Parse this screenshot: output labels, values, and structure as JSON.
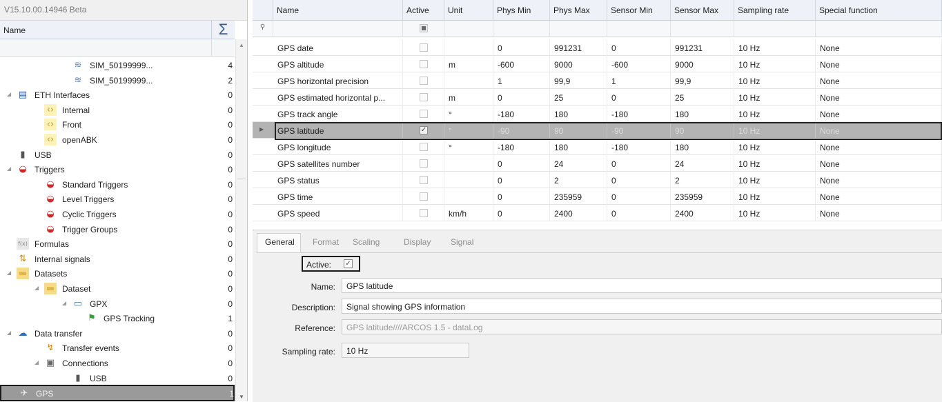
{
  "app": {
    "version": "V15.10.00.14946 Beta"
  },
  "tree": {
    "header_name": "Name",
    "header_sigma": "Σ",
    "rows": [
      {
        "label": "SIM_50199999...",
        "count": "4",
        "indent": 4,
        "icon": "signal-wave-icon",
        "expand": ""
      },
      {
        "label": "SIM_50199999...",
        "count": "2",
        "indent": 4,
        "icon": "signal-wave-icon",
        "expand": ""
      },
      {
        "label": "ETH Interfaces",
        "count": "0",
        "indent": 2,
        "icon": "ethernet-interface-icon",
        "expand": "◢"
      },
      {
        "label": "Internal",
        "count": "0",
        "indent": 3,
        "icon": "interface-port-icon",
        "expand": ""
      },
      {
        "label": "Front",
        "count": "0",
        "indent": 3,
        "icon": "interface-port-icon",
        "expand": ""
      },
      {
        "label": "openABK",
        "count": "0",
        "indent": 3,
        "icon": "interface-port-icon",
        "expand": ""
      },
      {
        "label": "USB",
        "count": "0",
        "indent": 2,
        "icon": "usb-icon",
        "expand": ""
      },
      {
        "label": "Triggers",
        "count": "0",
        "indent": 2,
        "icon": "trigger-icon",
        "expand": "◢"
      },
      {
        "label": "Standard Triggers",
        "count": "0",
        "indent": 3,
        "icon": "standard-trigger-icon",
        "expand": ""
      },
      {
        "label": "Level Triggers",
        "count": "0",
        "indent": 3,
        "icon": "level-trigger-icon",
        "expand": ""
      },
      {
        "label": "Cyclic Triggers",
        "count": "0",
        "indent": 3,
        "icon": "cyclic-trigger-icon",
        "expand": ""
      },
      {
        "label": "Trigger Groups",
        "count": "0",
        "indent": 3,
        "icon": "trigger-group-icon",
        "expand": ""
      },
      {
        "label": "Formulas",
        "count": "0",
        "indent": 2,
        "icon": "formula-icon",
        "expand": ""
      },
      {
        "label": "Internal signals",
        "count": "0",
        "indent": 2,
        "icon": "internal-signals-icon",
        "expand": ""
      },
      {
        "label": "Datasets",
        "count": "0",
        "indent": 2,
        "icon": "folder-icon",
        "expand": "◢"
      },
      {
        "label": "Dataset",
        "count": "0",
        "indent": 3,
        "icon": "folder-icon",
        "expand": "◢"
      },
      {
        "label": "GPX",
        "count": "0",
        "indent": 4,
        "icon": "gpx-file-icon",
        "expand": "◢"
      },
      {
        "label": "GPS Tracking",
        "count": "1",
        "indent": 5,
        "icon": "gps-tracking-icon",
        "expand": ""
      },
      {
        "label": "Data transfer",
        "count": "0",
        "indent": 2,
        "icon": "data-transfer-icon",
        "expand": "◢"
      },
      {
        "label": "Transfer events",
        "count": "0",
        "indent": 3,
        "icon": "transfer-event-icon",
        "expand": ""
      },
      {
        "label": "Connections",
        "count": "0",
        "indent": 3,
        "icon": "connection-icon",
        "expand": "◢"
      },
      {
        "label": "USB",
        "count": "0",
        "indent": 4,
        "icon": "usb-icon",
        "expand": ""
      },
      {
        "label": "GPS",
        "count": "1",
        "indent": 2,
        "icon": "gps-satellite-icon",
        "expand": "",
        "selected": true
      }
    ]
  },
  "grid": {
    "columns": [
      "Name",
      "Active",
      "Unit",
      "Phys Min",
      "Phys Max",
      "Sensor Min",
      "Sensor Max",
      "Sampling rate",
      "Special function"
    ],
    "rows": [
      {
        "name": "GPS date",
        "active": false,
        "unit": "",
        "phys_min": "0",
        "phys_max": "991231",
        "sensor_min": "0",
        "sensor_max": "991231",
        "rate": "10 Hz",
        "special": "None"
      },
      {
        "name": "GPS altitude",
        "active": false,
        "unit": "m",
        "phys_min": "-600",
        "phys_max": "9000",
        "sensor_min": "-600",
        "sensor_max": "9000",
        "rate": "10 Hz",
        "special": "None"
      },
      {
        "name": "GPS horizontal precision",
        "active": false,
        "unit": "",
        "phys_min": "1",
        "phys_max": "99,9",
        "sensor_min": "1",
        "sensor_max": "99,9",
        "rate": "10 Hz",
        "special": "None"
      },
      {
        "name": "GPS estimated horizontal p...",
        "active": false,
        "unit": "m",
        "phys_min": "0",
        "phys_max": "25",
        "sensor_min": "0",
        "sensor_max": "25",
        "rate": "10 Hz",
        "special": "None"
      },
      {
        "name": "GPS track angle",
        "active": false,
        "unit": "°",
        "phys_min": "-180",
        "phys_max": "180",
        "sensor_min": "-180",
        "sensor_max": "180",
        "rate": "10 Hz",
        "special": "None"
      },
      {
        "name": "GPS latitude",
        "active": true,
        "unit": "°",
        "phys_min": "-90",
        "phys_max": "90",
        "sensor_min": "-90",
        "sensor_max": "90",
        "rate": "10 Hz",
        "special": "None",
        "selected": true
      },
      {
        "name": "GPS longitude",
        "active": false,
        "unit": "°",
        "phys_min": "-180",
        "phys_max": "180",
        "sensor_min": "-180",
        "sensor_max": "180",
        "rate": "10 Hz",
        "special": "None"
      },
      {
        "name": "GPS satellites number",
        "active": false,
        "unit": "",
        "phys_min": "0",
        "phys_max": "24",
        "sensor_min": "0",
        "sensor_max": "24",
        "rate": "10 Hz",
        "special": "None"
      },
      {
        "name": "GPS status",
        "active": false,
        "unit": "",
        "phys_min": "0",
        "phys_max": "2",
        "sensor_min": "0",
        "sensor_max": "2",
        "rate": "10 Hz",
        "special": "None"
      },
      {
        "name": "GPS time",
        "active": false,
        "unit": "",
        "phys_min": "0",
        "phys_max": "235959",
        "sensor_min": "0",
        "sensor_max": "235959",
        "rate": "10 Hz",
        "special": "None"
      },
      {
        "name": "GPS speed",
        "active": false,
        "unit": "km/h",
        "phys_min": "0",
        "phys_max": "2400",
        "sensor_min": "0",
        "sensor_max": "2400",
        "rate": "10 Hz",
        "special": "None"
      }
    ]
  },
  "details": {
    "tabs": [
      "General",
      "Format",
      "Scaling",
      "Display",
      "Signal"
    ],
    "active_label": "Active:",
    "active_checked": true,
    "name_label": "Name:",
    "name_value": "GPS latitude",
    "description_label": "Description:",
    "description_value": "Signal showing GPS information",
    "reference_label": "Reference:",
    "reference_value": "GPS latitude////ARCOS 1.5 - dataLog",
    "sampling_label": "Sampling rate:",
    "sampling_value": "10 Hz"
  },
  "colors": {
    "selection": "#9a9a9a",
    "header_bg": "#eef2f8",
    "accent_sigma": "#3a5a8a"
  }
}
